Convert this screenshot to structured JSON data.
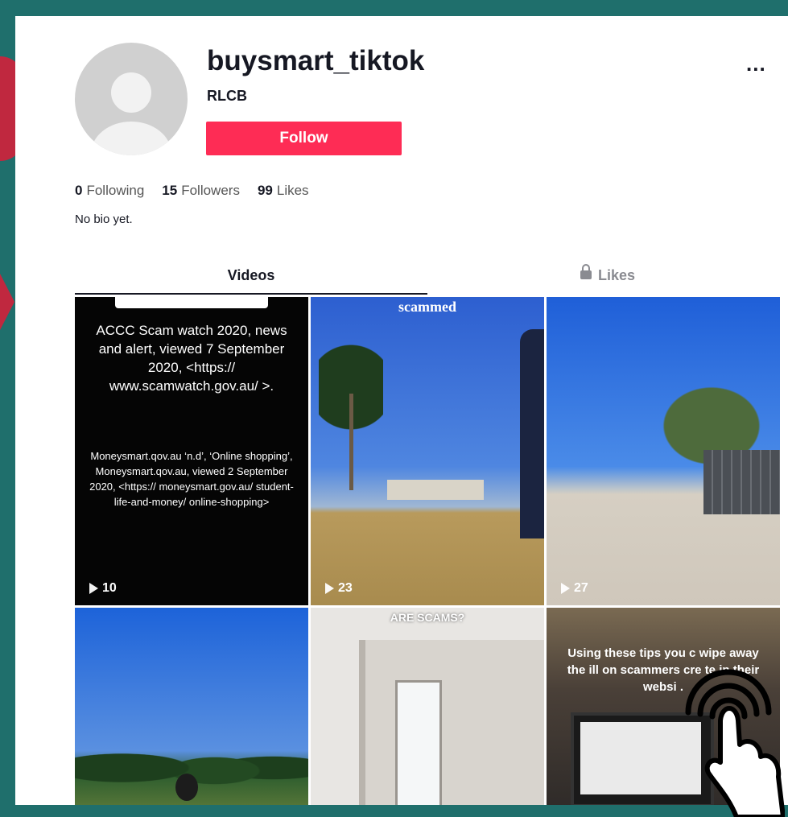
{
  "profile": {
    "username": "buysmart_tiktok",
    "nickname": "RLCB",
    "follow_label": "Follow",
    "more_label": "...",
    "bio": "No bio yet."
  },
  "stats": {
    "following_count": "0",
    "following_label": "Following",
    "followers_count": "15",
    "followers_label": "Followers",
    "likes_count": "99",
    "likes_label": "Likes"
  },
  "tabs": {
    "videos": "Videos",
    "likes": "Likes"
  },
  "videos": [
    {
      "views": "10",
      "title": "ACCC Scam watch 2020, news and alert, viewed 7 September 2020, <https:// www.scamwatch.gov.au/ >.",
      "body": "Moneysmart.qov.au ‘n.d’, ‘Online shopping’, Moneysmart.qov.au, viewed 2 September 2020, <https:// moneysmart.gov.au/ student-life-and-money/ online-shopping>"
    },
    {
      "views": "23",
      "caption": "scammed"
    },
    {
      "views": "27"
    },
    {},
    {
      "caption": "ARE SCAMS?"
    },
    {
      "caption": "Using these tips you c wipe away the ill on scammers cre te in their websi ."
    }
  ],
  "colors": {
    "accent": "#fe2c55",
    "frame": "#1f6f6c",
    "text": "#161823",
    "muted": "#8a8b91"
  },
  "icons": {
    "play": "play-icon",
    "lock": "lock-icon",
    "more": "more-icon",
    "tap": "tap-gesture-icon"
  }
}
